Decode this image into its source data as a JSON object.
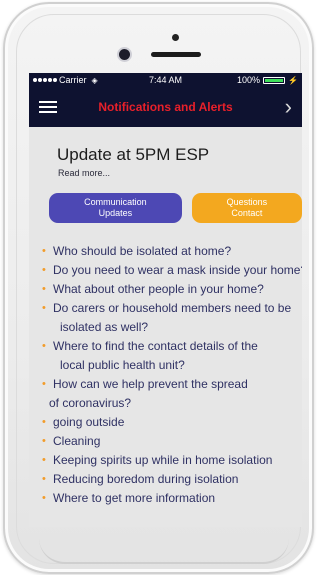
{
  "status_bar": {
    "carrier": "Carrier",
    "time": "7:44 AM",
    "battery": "100%",
    "battery_level": 1.0
  },
  "nav": {
    "title": "Notifications and Alerts",
    "menu_icon": "hamburger-menu-icon",
    "forward_icon": "chevron-right-icon",
    "title_color": "#e8202a",
    "bar_color": "#0e1230"
  },
  "update": {
    "title": "Update at 5PM ESP",
    "read_more": "Read more..."
  },
  "buttons": {
    "communication": {
      "line1": "Communication",
      "line2": "Updates",
      "color": "#4d48b4"
    },
    "questions": {
      "line1": "Questions",
      "line2": "Contact",
      "color": "#f3a81f"
    }
  },
  "faq": {
    "bullet_color": "#f29c2b",
    "items": [
      {
        "line1": "Who should be isolated at home?"
      },
      {
        "line1": "Do you need to wear a mask inside your home?"
      },
      {
        "line1": "What about other people in your home?"
      },
      {
        "line1": "Do carers or household members need to be",
        "line2": "isolated as well?"
      },
      {
        "line1": "Where to find the contact details of the",
        "line2": "local public health unit?"
      },
      {
        "line1": "How can we help prevent the spread",
        "line2": "of coronavirus?"
      },
      {
        "line1": "going outside"
      },
      {
        "line1": "Cleaning"
      },
      {
        "line1": "Keeping spirits up while in home isolation"
      },
      {
        "line1": "Reducing boredom during isolation"
      },
      {
        "line1": "Where to get more information"
      }
    ]
  }
}
